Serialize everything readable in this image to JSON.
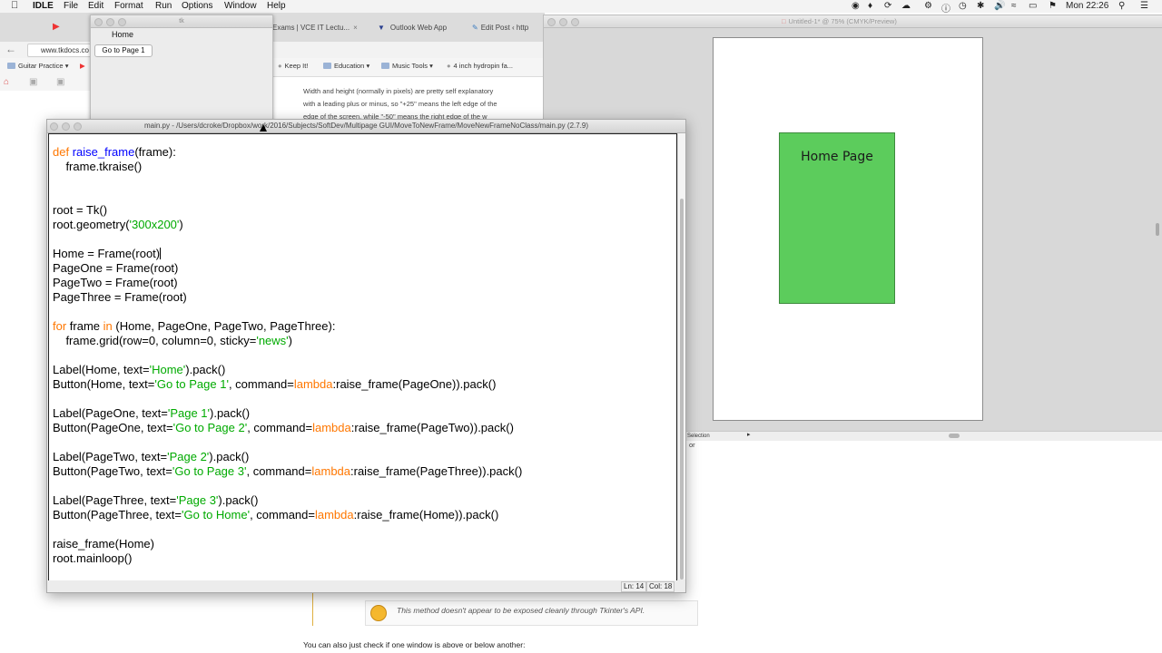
{
  "menubar": {
    "app_name": "IDLE",
    "items": [
      "File",
      "Edit",
      "Format",
      "Run",
      "Options",
      "Window",
      "Help"
    ],
    "clock": "Mon 22:26"
  },
  "browser": {
    "tabs": [
      {
        "label": "Exams | VCE IT Lectu..."
      },
      {
        "label": "Outlook Web App"
      },
      {
        "label": "Edit Post ‹ http"
      }
    ],
    "url": "www.tkdocs.co",
    "bookmarks": [
      "Guitar Practice",
      "Keep It!",
      "Education",
      "Music Tools",
      "4 inch hydropin fa..."
    ],
    "page_text_lines": [
      "Width and height (normally in pixels) are pretty self explanatory",
      "with a leading plus or minus, so \"+25\" means the left edge of the",
      "edge of the screen, while \"-50\" means the right edge of the w"
    ],
    "side_fragment": "or",
    "comment": "This method doesn't appear to be exposed cleanly through Tkinter's API.",
    "bottom_text": "You can also just check if one window is above or below another:"
  },
  "tk_window": {
    "title": "tk",
    "label": "Home",
    "button": "Go to Page 1"
  },
  "preview": {
    "title": "Untitled-1* @ 75% (CMYK/Preview)",
    "shape_text": "Home Page",
    "status_label": "Selection",
    "colors": {
      "shape_fill": "#5ccc5c"
    }
  },
  "idle": {
    "title": "main.py - /Users/dcroke/Dropbox/work/2016/Subjects/SoftDev/Multipage GUI/MoveToNewFrame/MoveNewFrameNoClass/main.py (2.7.9)",
    "status_ln": "Ln: 14",
    "status_col": "Col: 18",
    "code_lines": [
      [
        {
          "t": "def ",
          "c": "kw"
        },
        {
          "t": "raise_frame",
          "c": "fn"
        },
        {
          "t": "(frame):"
        }
      ],
      [
        {
          "t": "    frame.tkraise()"
        }
      ],
      [],
      [],
      [
        {
          "t": "root = Tk()"
        }
      ],
      [
        {
          "t": "root.geometry("
        },
        {
          "t": "'300x200'",
          "c": "str"
        },
        {
          "t": ")"
        }
      ],
      [],
      [
        {
          "t": "Home = Frame(root)"
        },
        {
          "caret": true
        }
      ],
      [
        {
          "t": "PageOne = Frame(root)"
        }
      ],
      [
        {
          "t": "PageTwo = Frame(root)"
        }
      ],
      [
        {
          "t": "PageThree = Frame(root)"
        }
      ],
      [],
      [
        {
          "t": "for",
          "c": "kw"
        },
        {
          "t": " frame "
        },
        {
          "t": "in",
          "c": "kw"
        },
        {
          "t": " (Home, PageOne, PageTwo, PageThree):"
        }
      ],
      [
        {
          "t": "    frame.grid(row=0, column=0, sticky="
        },
        {
          "t": "'news'",
          "c": "str"
        },
        {
          "t": ")"
        }
      ],
      [],
      [
        {
          "t": "Label(Home, text="
        },
        {
          "t": "'Home'",
          "c": "str"
        },
        {
          "t": ").pack()"
        }
      ],
      [
        {
          "t": "Button(Home, text="
        },
        {
          "t": "'Go to Page 1'",
          "c": "str"
        },
        {
          "t": ", command="
        },
        {
          "t": "lambda",
          "c": "kw"
        },
        {
          "t": ":raise_frame(PageOne)).pack()"
        }
      ],
      [],
      [
        {
          "t": "Label(PageOne, text="
        },
        {
          "t": "'Page 1'",
          "c": "str"
        },
        {
          "t": ").pack()"
        }
      ],
      [
        {
          "t": "Button(PageOne, text="
        },
        {
          "t": "'Go to Page 2'",
          "c": "str"
        },
        {
          "t": ", command="
        },
        {
          "t": "lambda",
          "c": "kw"
        },
        {
          "t": ":raise_frame(PageTwo)).pack()"
        }
      ],
      [],
      [
        {
          "t": "Label(PageTwo, text="
        },
        {
          "t": "'Page 2'",
          "c": "str"
        },
        {
          "t": ").pack()"
        }
      ],
      [
        {
          "t": "Button(PageTwo, text="
        },
        {
          "t": "'Go to Page 3'",
          "c": "str"
        },
        {
          "t": ", command="
        },
        {
          "t": "lambda",
          "c": "kw"
        },
        {
          "t": ":raise_frame(PageThree)).pack()"
        }
      ],
      [],
      [
        {
          "t": "Label(PageThree, text="
        },
        {
          "t": "'Page 3'",
          "c": "str"
        },
        {
          "t": ").pack()"
        }
      ],
      [
        {
          "t": "Button(PageThree, text="
        },
        {
          "t": "'Go to Home'",
          "c": "str"
        },
        {
          "t": ", command="
        },
        {
          "t": "lambda",
          "c": "kw"
        },
        {
          "t": ":raise_frame(Home)).pack()"
        }
      ],
      [],
      [
        {
          "t": "raise_frame(Home)"
        }
      ],
      [
        {
          "t": "root.mainloop()"
        }
      ]
    ],
    "colors": {
      "keyword": "#ff7700",
      "builtin": "#0000ff",
      "string": "#00aa00"
    }
  }
}
